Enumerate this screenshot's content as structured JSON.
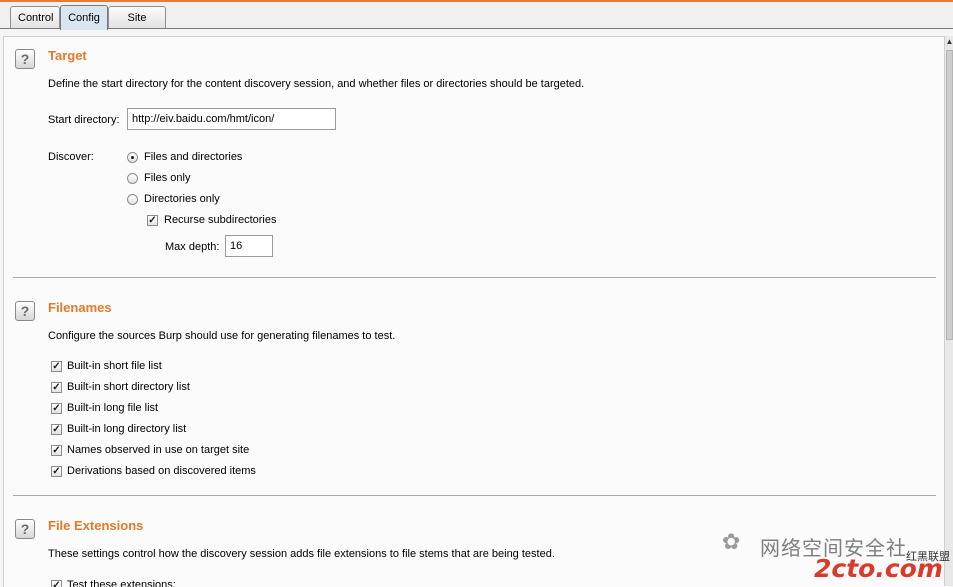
{
  "tabs": [
    "Control",
    "Config",
    "Site map"
  ],
  "target": {
    "heading": "Target",
    "description": "Define the start directory for the content discovery session, and whether files or directories should be targeted.",
    "start_dir_label": "Start directory:",
    "start_dir_value": "http://eiv.baidu.com/hmt/icon/",
    "discover_label": "Discover:",
    "options": [
      "Files and directories",
      "Files only",
      "Directories only"
    ],
    "selected_option": "Files and directories",
    "recurse_label": "Recurse subdirectories",
    "recurse_checked": true,
    "max_depth_label": "Max depth:",
    "max_depth_value": "16"
  },
  "filenames": {
    "heading": "Filenames",
    "description": "Configure the sources Burp should use for generating filenames to test.",
    "items": [
      "Built-in short file list",
      "Built-in short directory list",
      "Built-in long file list",
      "Built-in long directory list",
      "Names observed in use on target site",
      "Derivations based on discovered items"
    ]
  },
  "file_extensions": {
    "heading": "File Extensions",
    "description": "These settings control how the discovery session adds file extensions to file stems that are being tested.",
    "first_item": "Test these extensions:"
  },
  "help_icon_glyph": "?",
  "check_glyph": "✓",
  "watermark": {
    "text": "网络空间安全社",
    "site": "2cto.com",
    "tag": "红黑联盟",
    "icon_glyph": "✿"
  },
  "colors": {
    "heading": "#e07b2a",
    "accent_line": "#e8793b",
    "watermark": "#d93a2a"
  }
}
